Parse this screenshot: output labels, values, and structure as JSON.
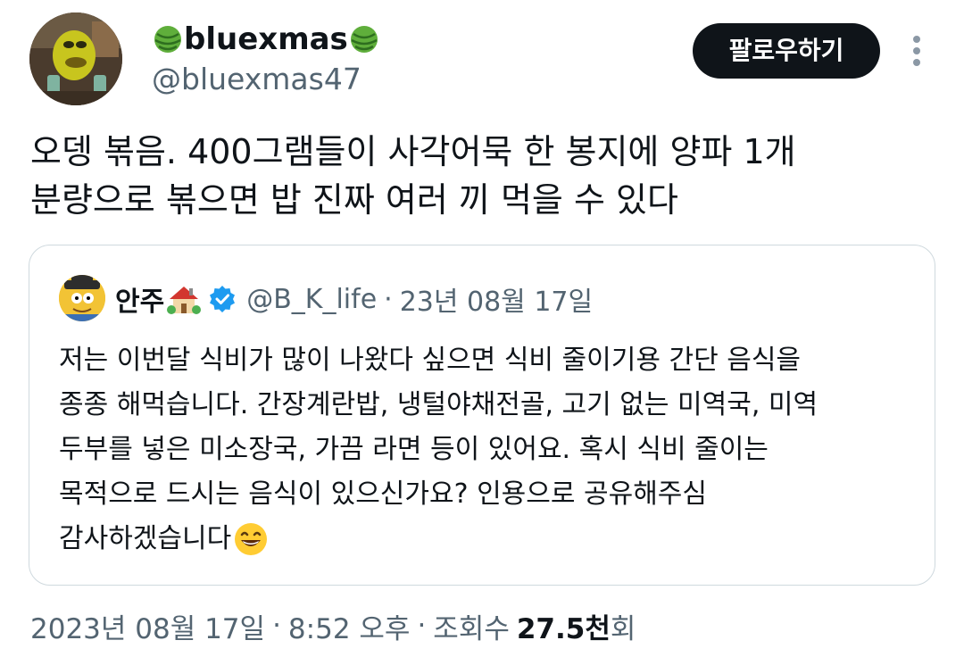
{
  "tweet": {
    "author": {
      "name": "bluexmas",
      "handle": "@bluexmas47"
    },
    "follow_label": "팔로우하기",
    "text_lines": [
      "오뎅 볶음. 400그램들이 사각어묵 한 봉지에 양파 1개",
      "분량으로 볶으면 밥 진짜 여러 끼 먹을 수 있다"
    ],
    "quote": {
      "name": "안주",
      "handle": "@B_K_life",
      "separator": "·",
      "date": "23년 08월 17일",
      "text_lines": [
        "저는 이번달 식비가 많이 나왔다 싶으면 식비 줄이기용 간단 음식을",
        "종종 해먹습니다. 간장계란밥, 냉털야채전골, 고기 없는 미역국, 미역",
        "두부를 넣은 미소장국, 가끔 라면 등이 있어요. 혹시 식비 줄이는",
        "목적으로 드시는 음식이 있으신가요? 인용으로 공유해주심",
        "감사하겠습니다"
      ]
    },
    "meta": {
      "date": "2023년 08월 17일",
      "time": "8:52 오후",
      "separator": "·",
      "views_label": "조회수",
      "views_count": "27.5천",
      "views_suffix": "회"
    }
  },
  "colors": {
    "text_primary": "#0f1419",
    "text_secondary": "#536471",
    "border": "#cfd9de",
    "verified": "#1d9bf0",
    "follow_bg": "#0f1419"
  },
  "icons": {
    "name_left": "watermelon-ball-icon",
    "name_right": "watermelon-ball-icon",
    "quote_name": "house-garden-icon",
    "verified": "verified-badge-icon",
    "text_end": "grinning-face-icon",
    "more": "more-options-icon"
  }
}
